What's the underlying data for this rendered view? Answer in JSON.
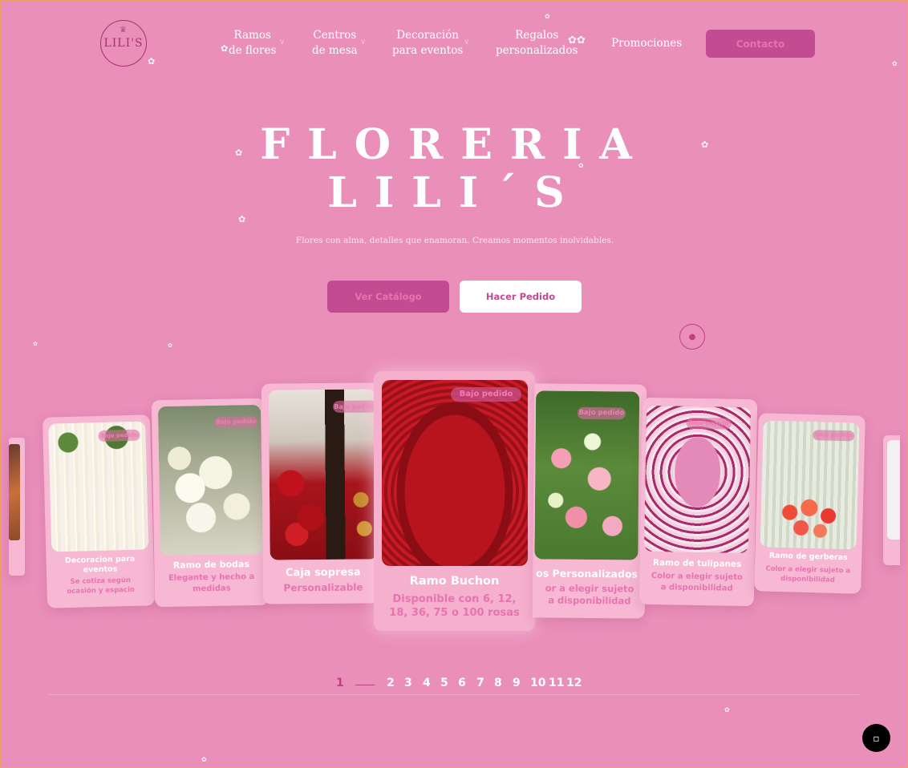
{
  "brand": {
    "logo_text": "LILI'S"
  },
  "nav": {
    "items": [
      {
        "line1": "Ramos",
        "line2": "de flores"
      },
      {
        "line1": "Centros",
        "line2": "de mesa"
      },
      {
        "line1": "Decoración",
        "line2": "para eventos"
      },
      {
        "line1": "Regalos",
        "line2": "personalizados"
      },
      {
        "line1": "Promociones",
        "line2": ""
      }
    ],
    "contact_label": "Contacto"
  },
  "hero": {
    "title_line1": "FLORERIA",
    "title_line2": "LILI´S",
    "subtitle": "Flores con alma, detalles que enamoran. Creamos momentos inolvidables.",
    "primary_button": "Ver Catálogo",
    "secondary_button": "Hacer Pedido"
  },
  "cards": [
    {
      "title": "Decoracion para eventos",
      "desc": "Se cotiza según ocasión y espacio",
      "badge": "Bajo pedido"
    },
    {
      "title": "Ramo de bodas",
      "desc": "Elegante y hecho a medidas",
      "badge": "Bajo pedido"
    },
    {
      "title": "Caja sopresa",
      "desc": "Personalizable",
      "badge": "Bajo pedido"
    },
    {
      "title": "Ramo Buchon",
      "desc": "Disponible con 6, 12, 18, 36, 75 o 100 rosas",
      "badge": "Bajo pedido"
    },
    {
      "title": "os Personalizados",
      "desc": "or a elegir sujeto a disponibilidad",
      "badge": "Bajo pedido"
    },
    {
      "title": "Ramo de tulipanes",
      "desc": "Color a elegir sujeto a disponibilidad",
      "badge": "Bajo pedido"
    },
    {
      "title": "Ramo de gerberas",
      "desc": "Color a elegir sujeto a disponibilidad",
      "badge": "Bajo pedido"
    }
  ],
  "pagination": {
    "current": "1",
    "pages": [
      "2",
      "3",
      "4",
      "5",
      "6",
      "7",
      "8",
      "9",
      "10",
      "11",
      "12"
    ]
  },
  "colors": {
    "background": "#e98fba",
    "accent": "#c24b91",
    "card": "#f6b8d2",
    "pink_text": "#e873b0"
  }
}
